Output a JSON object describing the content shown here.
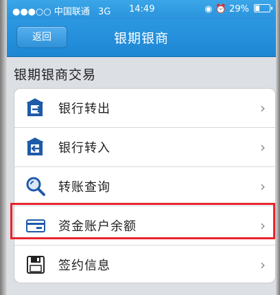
{
  "status_bar": {
    "signal": "●●●○○",
    "carrier": "中国联通",
    "network": "3G",
    "time": "14:49",
    "battery": "29%"
  },
  "nav": {
    "back_label": "返回",
    "title": "银期银商"
  },
  "section": {
    "title": "银期银商交易"
  },
  "menu": {
    "items": [
      {
        "label": "银行转出",
        "icon": "bank-transfer-out-icon"
      },
      {
        "label": "银行转入",
        "icon": "bank-transfer-in-icon"
      },
      {
        "label": "转账查询",
        "icon": "magnifier-query-icon"
      },
      {
        "label": "资金账户余额",
        "icon": "card-balance-icon"
      },
      {
        "label": "签约信息",
        "icon": "save-contract-icon"
      }
    ],
    "chevron": "›"
  },
  "colors": {
    "navbar": "#2a93dc",
    "highlight": "#e8242b",
    "icon_blue": "#1e5aa8"
  }
}
